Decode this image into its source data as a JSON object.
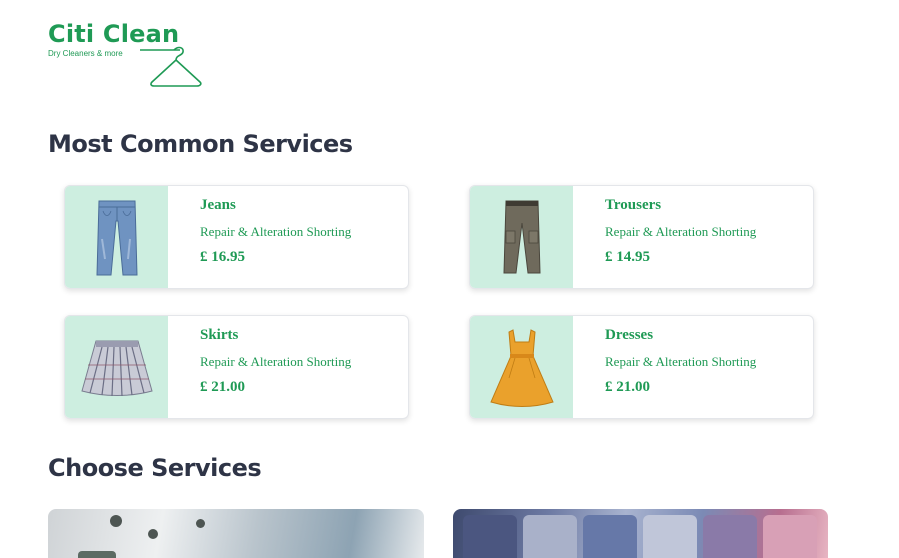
{
  "brand": {
    "name": "Citi Clean",
    "tagline": "Dry Cleaners & more"
  },
  "sections": {
    "common_title": "Most Common Services",
    "choose_title": "Choose Services"
  },
  "services": [
    {
      "name": "Jeans",
      "description": "Repair & Alteration Shorting",
      "price": "£ 16.95",
      "icon": "jeans-icon"
    },
    {
      "name": "Trousers",
      "description": "Repair & Alteration Shorting",
      "price": "£ 14.95",
      "icon": "trousers-icon"
    },
    {
      "name": "Skirts",
      "description": "Repair & Alteration Shorting",
      "price": "£ 21.00",
      "icon": "skirt-icon"
    },
    {
      "name": "Dresses",
      "description": "Repair & Alteration Shorting",
      "price": "£ 21.00",
      "icon": "dress-icon"
    }
  ],
  "colors": {
    "brand_green": "#1f9a55",
    "thumb_bg": "#cdeee0",
    "heading": "#2e3446"
  }
}
